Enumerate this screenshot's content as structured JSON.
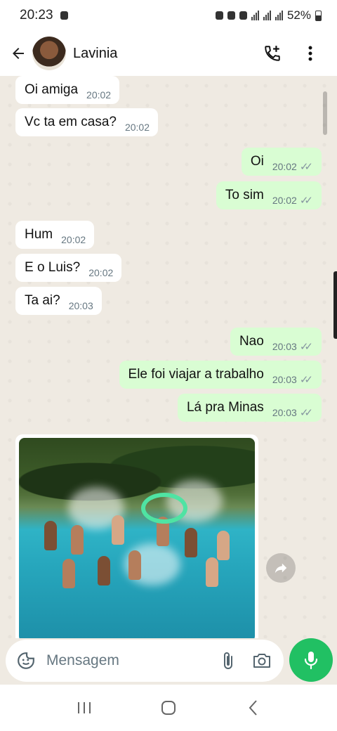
{
  "status_bar": {
    "time": "20:23",
    "battery": "52%"
  },
  "header": {
    "contact_name": "Lavinia"
  },
  "messages": [
    {
      "dir": "in",
      "text": "Oi amiga",
      "time": "20:02"
    },
    {
      "dir": "in",
      "text": "Vc ta em casa?",
      "time": "20:02"
    },
    {
      "dir": "out",
      "text": "Oi",
      "time": "20:02",
      "status": "read"
    },
    {
      "dir": "out",
      "text": "To sim",
      "time": "20:02",
      "status": "read"
    },
    {
      "dir": "in",
      "text": "Hum",
      "time": "20:02"
    },
    {
      "dir": "in",
      "text": "E o Luis?",
      "time": "20:02"
    },
    {
      "dir": "in",
      "text": "Ta ai?",
      "time": "20:03"
    },
    {
      "dir": "out",
      "text": "Nao",
      "time": "20:03",
      "status": "read"
    },
    {
      "dir": "out",
      "text": "Ele foi viajar a trabalho",
      "time": "20:03",
      "status": "read"
    },
    {
      "dir": "out",
      "text": "Lá pra Minas",
      "time": "20:03",
      "status": "read"
    }
  ],
  "input": {
    "placeholder": "Mensagem"
  },
  "colors": {
    "accent": "#21c063",
    "outgoing_bubble": "#d9fdd3",
    "chat_background": "#efeae2",
    "highlight_circle": "#4fe3a3"
  },
  "icons": [
    "back-arrow-icon",
    "add-call-icon",
    "more-options-icon",
    "forward-icon",
    "scroll-down-icon",
    "sticker-icon",
    "attach-icon",
    "camera-icon",
    "mic-icon"
  ]
}
